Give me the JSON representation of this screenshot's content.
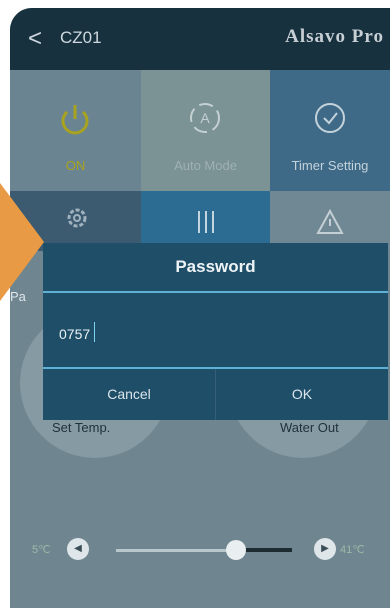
{
  "header": {
    "back_glyph": "<",
    "device_name": "CZ01",
    "brand": "Alsavo Pro"
  },
  "tiles": [
    {
      "id": "on",
      "label": "ON",
      "icon": "power-icon",
      "label_color": "#a8a21f"
    },
    {
      "id": "auto",
      "label": "Auto Mode",
      "icon": "auto-mode-icon",
      "label_color": "#9fb0b5"
    },
    {
      "id": "timer",
      "label": "Timer Setting",
      "icon": "clock-icon",
      "label_color": "#c4d2da"
    }
  ],
  "row2": {
    "left_icon": "gear-icon",
    "left_partial_label": "Pa",
    "middle_icon": "sliders-icon",
    "right_icon": "warning-icon"
  },
  "readouts": {
    "set_temp_label": "Set Temp.",
    "water_out_label": "Water Out"
  },
  "slider": {
    "min_label": "5℃",
    "max_label": "41℃",
    "level": 0.68
  },
  "dialog": {
    "title": "Password",
    "value": "0757",
    "cancel_label": "Cancel",
    "ok_label": "OK"
  },
  "colors": {
    "header": "#17313f",
    "dialog": "#1f4e68",
    "dialog_line": "#5fb0d5",
    "accent_orange": "#e89a44"
  }
}
